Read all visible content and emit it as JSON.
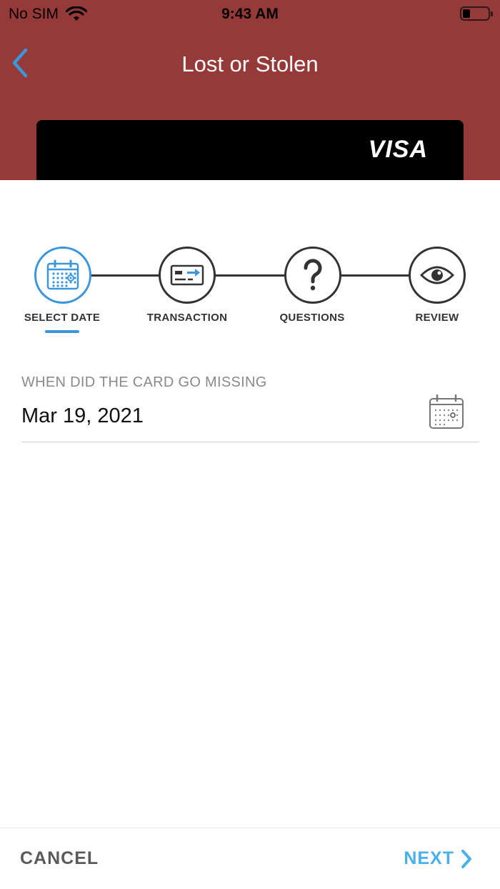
{
  "status_bar": {
    "carrier": "No SIM",
    "time": "9:43 AM",
    "battery_level": 0.3
  },
  "nav": {
    "title": "Lost or Stolen",
    "back_icon": "chevron-left-icon"
  },
  "card": {
    "brand": "VISA"
  },
  "stepper": {
    "active_step": 0,
    "steps": [
      {
        "label": "SELECT DATE",
        "icon": "calendar-icon"
      },
      {
        "label": "TRANSACTION",
        "icon": "card-transfer-icon"
      },
      {
        "label": "QUESTIONS",
        "icon": "question-mark-icon"
      },
      {
        "label": "REVIEW",
        "icon": "eye-icon"
      }
    ]
  },
  "date_field": {
    "label": "WHEN DID THE CARD GO MISSING",
    "value": "Mar 19, 2021",
    "icon": "calendar-icon"
  },
  "footer": {
    "cancel_label": "CANCEL",
    "next_label": "NEXT"
  },
  "colors": {
    "header_bg": "#953a38",
    "accent": "#3a97dd",
    "next_text": "#4ab0ea",
    "cancel_text": "#5a5a5a"
  }
}
